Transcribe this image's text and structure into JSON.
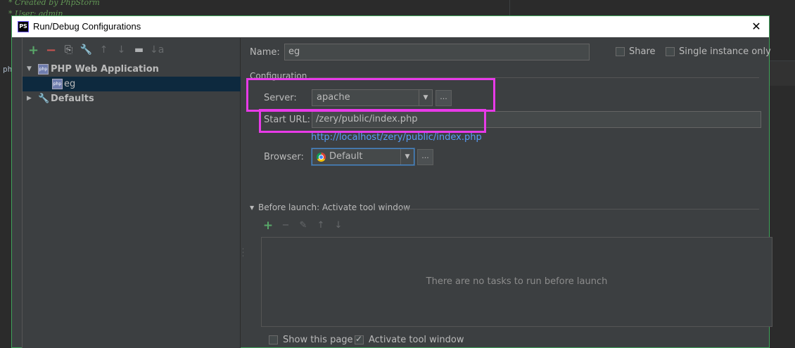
{
  "editor": {
    "line1": "* Created by PhpStorm",
    "line2": "* User: admin",
    "side_text": "ph"
  },
  "titlebar": {
    "app_icon": "PS",
    "title": "Run/Debug Configurations",
    "close": "✕"
  },
  "toolbar": {
    "add": "+",
    "remove": "−",
    "copy": "⎘",
    "edit_defaults": "🔧",
    "move_up": "↑",
    "move_down": "↓",
    "folder": "▬",
    "sort": "↓a"
  },
  "tree": {
    "group_label": "PHP Web Application",
    "group_expanded": "▼",
    "child_label": "eg",
    "defaults_label": "Defaults",
    "defaults_collapsed": "▶",
    "php_icon": "php"
  },
  "form": {
    "name_label": "Name:",
    "name_value": "eg",
    "share_label": "Share",
    "single_instance_label": "Single instance only",
    "configuration_label": "Configuration",
    "server_label": "Server:",
    "server_value": "apache",
    "start_url_label": "Start URL:",
    "start_url_value": "/zery/public/index.php",
    "resolved_url": "http://localhost/zery/public/index.php",
    "browser_label": "Browser:",
    "browser_value": "Default",
    "dots": "...",
    "combo_arrow": "▼"
  },
  "before_launch": {
    "header": "Before launch: Activate tool window",
    "collapse_icon": "▼",
    "add": "+",
    "remove": "−",
    "edit": "✎",
    "up": "↑",
    "down": "↓",
    "empty_text": "There are no tasks to run before launch"
  },
  "footer": {
    "show_page_label": "Show this page",
    "activate_tool_window_label": "Activate tool window"
  },
  "colors": {
    "accent_highlight": "#e83ae8",
    "link": "#589df6",
    "add_green": "#59a869",
    "remove_red": "#c75450"
  }
}
